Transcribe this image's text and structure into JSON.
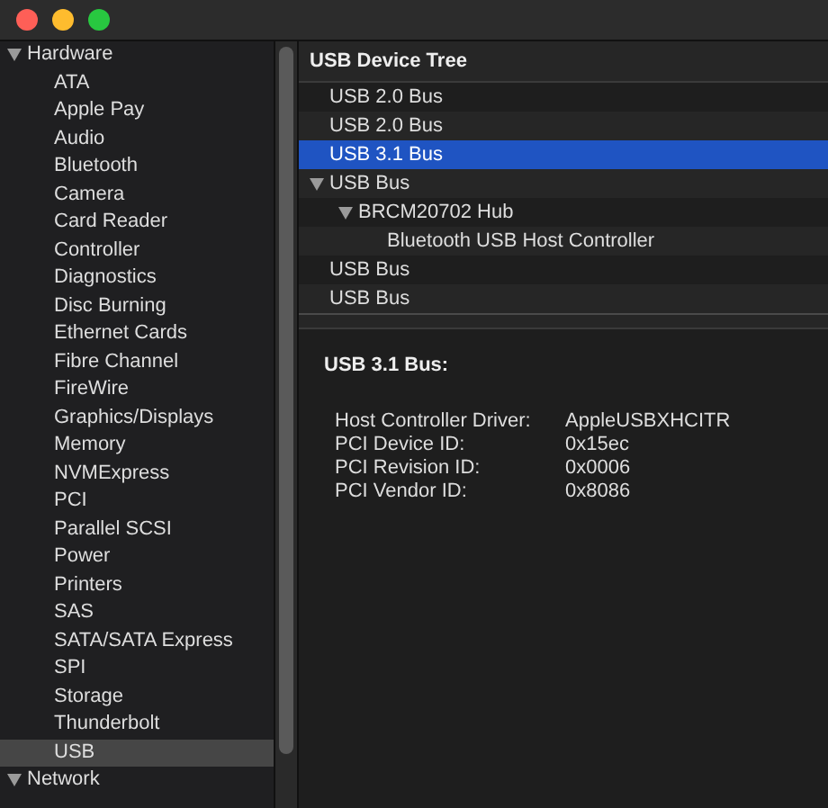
{
  "sidebar": {
    "items": [
      {
        "label": "Hardware",
        "expanded": true,
        "selected": false,
        "children": [
          {
            "label": "ATA",
            "selected": false
          },
          {
            "label": "Apple Pay",
            "selected": false
          },
          {
            "label": "Audio",
            "selected": false
          },
          {
            "label": "Bluetooth",
            "selected": false
          },
          {
            "label": "Camera",
            "selected": false
          },
          {
            "label": "Card Reader",
            "selected": false
          },
          {
            "label": "Controller",
            "selected": false
          },
          {
            "label": "Diagnostics",
            "selected": false
          },
          {
            "label": "Disc Burning",
            "selected": false
          },
          {
            "label": "Ethernet Cards",
            "selected": false
          },
          {
            "label": "Fibre Channel",
            "selected": false
          },
          {
            "label": "FireWire",
            "selected": false
          },
          {
            "label": "Graphics/Displays",
            "selected": false
          },
          {
            "label": "Memory",
            "selected": false
          },
          {
            "label": "NVMExpress",
            "selected": false
          },
          {
            "label": "PCI",
            "selected": false
          },
          {
            "label": "Parallel SCSI",
            "selected": false
          },
          {
            "label": "Power",
            "selected": false
          },
          {
            "label": "Printers",
            "selected": false
          },
          {
            "label": "SAS",
            "selected": false
          },
          {
            "label": "SATA/SATA Express",
            "selected": false
          },
          {
            "label": "SPI",
            "selected": false
          },
          {
            "label": "Storage",
            "selected": false
          },
          {
            "label": "Thunderbolt",
            "selected": false
          },
          {
            "label": "USB",
            "selected": true
          }
        ]
      },
      {
        "label": "Network",
        "expanded": true,
        "selected": false
      }
    ]
  },
  "device_tree": {
    "title": "USB Device Tree",
    "items": [
      {
        "label": "USB 2.0 Bus",
        "selected": false
      },
      {
        "label": "USB 2.0 Bus",
        "selected": false
      },
      {
        "label": "USB 3.1 Bus",
        "selected": true
      },
      {
        "label": "USB Bus",
        "expanded": true,
        "selected": false,
        "children": [
          {
            "label": "BRCM20702 Hub",
            "expanded": true,
            "selected": false,
            "children": [
              {
                "label": "Bluetooth USB Host Controller",
                "selected": false
              }
            ]
          }
        ]
      },
      {
        "label": "USB Bus",
        "selected": false
      },
      {
        "label": "USB Bus",
        "selected": false
      }
    ]
  },
  "details": {
    "title": "USB 3.1 Bus:",
    "properties": [
      {
        "label": "Host Controller Driver:",
        "value": "AppleUSBXHCITR"
      },
      {
        "label": "PCI Device ID:",
        "value": "0x15ec"
      },
      {
        "label": "PCI Revision ID:",
        "value": "0x0006"
      },
      {
        "label": "PCI Vendor ID:",
        "value": "0x8086"
      }
    ]
  }
}
